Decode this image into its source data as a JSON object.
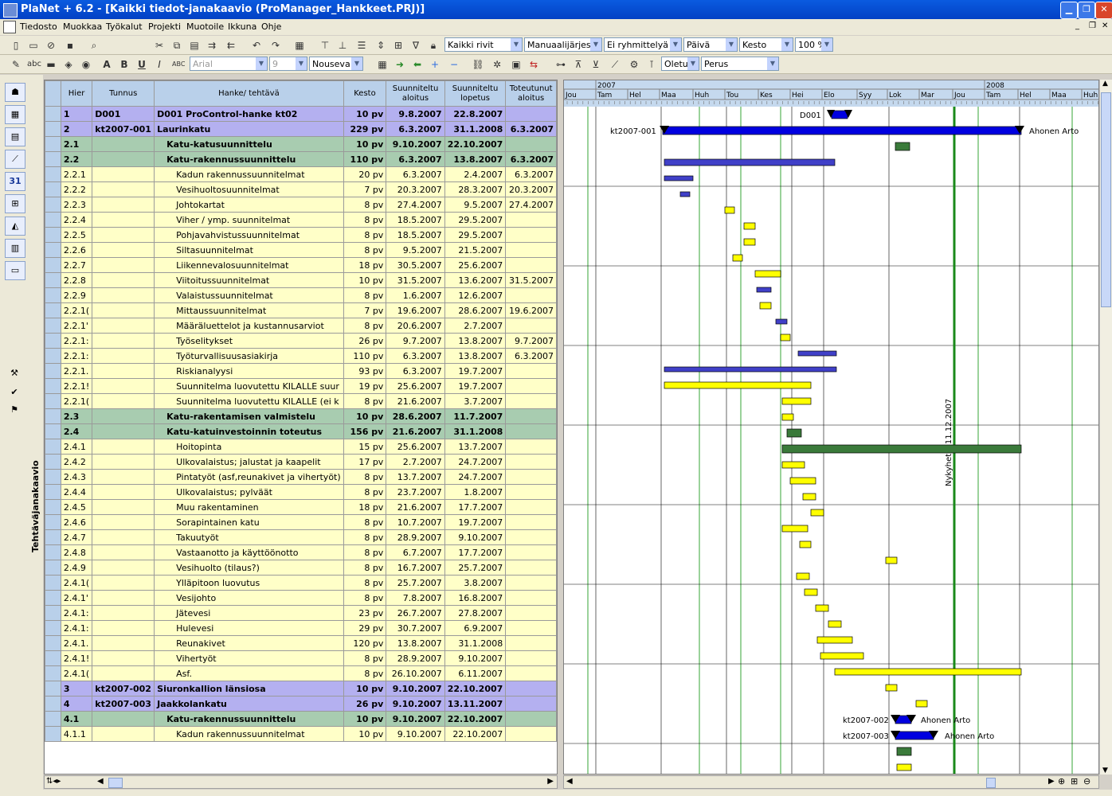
{
  "window": {
    "title": "PlaNet + 6.2 - [Kaikki tiedot-janakaavio (ProManager_Hankkeet.PRJ)]"
  },
  "menu": [
    "Tiedosto",
    "Muokkaa",
    "Työkalut",
    "Projekti",
    "Muotoile",
    "Ikkuna",
    "Ohje"
  ],
  "toolbar1": {
    "filter": "Kaikki rivit",
    "sort": "Manuaalijärjesty",
    "group": "Ei ryhmittelyä",
    "unit": "Päivä",
    "field": "Kesto",
    "zoom": "100 %"
  },
  "toolbar2": {
    "font": "Arial",
    "size": "9",
    "order": "Nouseva",
    "default": "Oletu:",
    "base": "Perus"
  },
  "side_tab": "Tehtäväjanakaavio",
  "columns": [
    "Hier",
    "Tunnus",
    "Hanke/ tehtävä",
    "Kesto",
    "Suunniteltu aloitus",
    "Suunniteltu lopetus",
    "Toteutunut aloitus"
  ],
  "rows": [
    {
      "hier": "1",
      "id": "D001",
      "name": "D001 ProControl-hanke kt02",
      "dur": "10 pv",
      "start": "9.8.2007",
      "end": "22.8.2007",
      "act": "",
      "type": "purple",
      "indent": 0
    },
    {
      "hier": "2",
      "id": "kt2007-001",
      "name": "Laurinkatu",
      "dur": "229 pv",
      "start": "6.3.2007",
      "end": "31.1.2008",
      "act": "6.3.2007",
      "type": "purple",
      "indent": 0
    },
    {
      "hier": "2.1",
      "id": "",
      "name": "Katu-katusuunnittelu",
      "dur": "10 pv",
      "start": "9.10.2007",
      "end": "22.10.2007",
      "act": "",
      "type": "green",
      "indent": 1
    },
    {
      "hier": "2.2",
      "id": "",
      "name": "Katu-rakennussuunnittelu",
      "dur": "110 pv",
      "start": "6.3.2007",
      "end": "13.8.2007",
      "act": "6.3.2007",
      "type": "green",
      "indent": 1
    },
    {
      "hier": "2.2.1",
      "id": "",
      "name": "Kadun rakennussuunnitelmat",
      "dur": "20 pv",
      "start": "6.3.2007",
      "end": "2.4.2007",
      "act": "6.3.2007",
      "type": "yellow",
      "indent": 2
    },
    {
      "hier": "2.2.2",
      "id": "",
      "name": "Vesihuoltosuunnitelmat",
      "dur": "7 pv",
      "start": "20.3.2007",
      "end": "28.3.2007",
      "act": "20.3.2007",
      "type": "yellow",
      "indent": 2
    },
    {
      "hier": "2.2.3",
      "id": "",
      "name": "Johtokartat",
      "dur": "8 pv",
      "start": "27.4.2007",
      "end": "9.5.2007",
      "act": "27.4.2007",
      "type": "yellow",
      "indent": 2
    },
    {
      "hier": "2.2.4",
      "id": "",
      "name": "Viher / ymp. suunnitelmat",
      "dur": "8 pv",
      "start": "18.5.2007",
      "end": "29.5.2007",
      "act": "",
      "type": "yellow",
      "indent": 2
    },
    {
      "hier": "2.2.5",
      "id": "",
      "name": "Pohjavahvistussuunnitelmat",
      "dur": "8 pv",
      "start": "18.5.2007",
      "end": "29.5.2007",
      "act": "",
      "type": "yellow",
      "indent": 2
    },
    {
      "hier": "2.2.6",
      "id": "",
      "name": "Siltasuunnitelmat",
      "dur": "8 pv",
      "start": "9.5.2007",
      "end": "21.5.2007",
      "act": "",
      "type": "yellow",
      "indent": 2
    },
    {
      "hier": "2.2.7",
      "id": "",
      "name": "Liikennevalosuunnitelmat",
      "dur": "18 pv",
      "start": "30.5.2007",
      "end": "25.6.2007",
      "act": "",
      "type": "yellow",
      "indent": 2
    },
    {
      "hier": "2.2.8",
      "id": "",
      "name": "Viitoitussuunnitelmat",
      "dur": "10 pv",
      "start": "31.5.2007",
      "end": "13.6.2007",
      "act": "31.5.2007",
      "type": "yellow",
      "indent": 2
    },
    {
      "hier": "2.2.9",
      "id": "",
      "name": "Valaistussuunnitelmat",
      "dur": "8 pv",
      "start": "1.6.2007",
      "end": "12.6.2007",
      "act": "",
      "type": "yellow",
      "indent": 2
    },
    {
      "hier": "2.2.1(",
      "id": "",
      "name": "Mittaussuunnitelmat",
      "dur": "7 pv",
      "start": "19.6.2007",
      "end": "28.6.2007",
      "act": "19.6.2007",
      "type": "yellow",
      "indent": 2
    },
    {
      "hier": "2.2.1'",
      "id": "",
      "name": "Määräluettelot ja kustannusarviot",
      "dur": "8 pv",
      "start": "20.6.2007",
      "end": "2.7.2007",
      "act": "",
      "type": "yellow",
      "indent": 2
    },
    {
      "hier": "2.2.1:",
      "id": "",
      "name": "Työselitykset",
      "dur": "26 pv",
      "start": "9.7.2007",
      "end": "13.8.2007",
      "act": "9.7.2007",
      "type": "yellow",
      "indent": 2
    },
    {
      "hier": "2.2.1:",
      "id": "",
      "name": "Työturvallisuusasiakirja",
      "dur": "110 pv",
      "start": "6.3.2007",
      "end": "13.8.2007",
      "act": "6.3.2007",
      "type": "yellow",
      "indent": 2
    },
    {
      "hier": "2.2.1.",
      "id": "",
      "name": "Riskianalyysi",
      "dur": "93 pv",
      "start": "6.3.2007",
      "end": "19.7.2007",
      "act": "",
      "type": "yellow",
      "indent": 2
    },
    {
      "hier": "2.2.1!",
      "id": "",
      "name": "Suunnitelma luovutettu KILALLE suur",
      "dur": "19 pv",
      "start": "25.6.2007",
      "end": "19.7.2007",
      "act": "",
      "type": "yellow",
      "indent": 2
    },
    {
      "hier": "2.2.1(",
      "id": "",
      "name": "Suunnitelma luovutettu KILALLE (ei k",
      "dur": "8 pv",
      "start": "21.6.2007",
      "end": "3.7.2007",
      "act": "",
      "type": "yellow",
      "indent": 2
    },
    {
      "hier": "2.3",
      "id": "",
      "name": "Katu-rakentamisen valmistelu",
      "dur": "10 pv",
      "start": "28.6.2007",
      "end": "11.7.2007",
      "act": "",
      "type": "green",
      "indent": 1
    },
    {
      "hier": "2.4",
      "id": "",
      "name": "Katu-katuinvestoinnin toteutus",
      "dur": "156 pv",
      "start": "21.6.2007",
      "end": "31.1.2008",
      "act": "",
      "type": "green",
      "indent": 1
    },
    {
      "hier": "2.4.1",
      "id": "",
      "name": "Hoitopinta",
      "dur": "15 pv",
      "start": "25.6.2007",
      "end": "13.7.2007",
      "act": "",
      "type": "yellow",
      "indent": 2
    },
    {
      "hier": "2.4.2",
      "id": "",
      "name": "Ulkovalaistus; jalustat ja kaapelit",
      "dur": "17 pv",
      "start": "2.7.2007",
      "end": "24.7.2007",
      "act": "",
      "type": "yellow",
      "indent": 2
    },
    {
      "hier": "2.4.3",
      "id": "",
      "name": "Pintatyöt (asf,reunakivet ja vihertyöt)",
      "dur": "8 pv",
      "start": "13.7.2007",
      "end": "24.7.2007",
      "act": "",
      "type": "yellow",
      "indent": 2
    },
    {
      "hier": "2.4.4",
      "id": "",
      "name": "Ulkovalaistus; pylväät",
      "dur": "8 pv",
      "start": "23.7.2007",
      "end": "1.8.2007",
      "act": "",
      "type": "yellow",
      "indent": 2
    },
    {
      "hier": "2.4.5",
      "id": "",
      "name": "Muu rakentaminen",
      "dur": "18 pv",
      "start": "21.6.2007",
      "end": "17.7.2007",
      "act": "",
      "type": "yellow",
      "indent": 2
    },
    {
      "hier": "2.4.6",
      "id": "",
      "name": "Sorapintainen katu",
      "dur": "8 pv",
      "start": "10.7.2007",
      "end": "19.7.2007",
      "act": "",
      "type": "yellow",
      "indent": 2
    },
    {
      "hier": "2.4.7",
      "id": "",
      "name": "Takuutyöt",
      "dur": "8 pv",
      "start": "28.9.2007",
      "end": "9.10.2007",
      "act": "",
      "type": "yellow",
      "indent": 2
    },
    {
      "hier": "2.4.8",
      "id": "",
      "name": "Vastaanotto ja käyttöönotto",
      "dur": "8 pv",
      "start": "6.7.2007",
      "end": "17.7.2007",
      "act": "",
      "type": "yellow",
      "indent": 2
    },
    {
      "hier": "2.4.9",
      "id": "",
      "name": "Vesihuolto (tilaus?)",
      "dur": "8 pv",
      "start": "16.7.2007",
      "end": "25.7.2007",
      "act": "",
      "type": "yellow",
      "indent": 2
    },
    {
      "hier": "2.4.1(",
      "id": "",
      "name": "Ylläpitoon luovutus",
      "dur": "8 pv",
      "start": "25.7.2007",
      "end": "3.8.2007",
      "act": "",
      "type": "yellow",
      "indent": 2
    },
    {
      "hier": "2.4.1'",
      "id": "",
      "name": "Vesijohto",
      "dur": "8 pv",
      "start": "7.8.2007",
      "end": "16.8.2007",
      "act": "",
      "type": "yellow",
      "indent": 2
    },
    {
      "hier": "2.4.1:",
      "id": "",
      "name": "Jätevesi",
      "dur": "23 pv",
      "start": "26.7.2007",
      "end": "27.8.2007",
      "act": "",
      "type": "yellow",
      "indent": 2
    },
    {
      "hier": "2.4.1:",
      "id": "",
      "name": "Hulevesi",
      "dur": "29 pv",
      "start": "30.7.2007",
      "end": "6.9.2007",
      "act": "",
      "type": "yellow",
      "indent": 2
    },
    {
      "hier": "2.4.1.",
      "id": "",
      "name": "Reunakivet",
      "dur": "120 pv",
      "start": "13.8.2007",
      "end": "31.1.2008",
      "act": "",
      "type": "yellow",
      "indent": 2
    },
    {
      "hier": "2.4.1!",
      "id": "",
      "name": "Vihertyöt",
      "dur": "8 pv",
      "start": "28.9.2007",
      "end": "9.10.2007",
      "act": "",
      "type": "yellow",
      "indent": 2
    },
    {
      "hier": "2.4.1(",
      "id": "",
      "name": "Asf.",
      "dur": "8 pv",
      "start": "26.10.2007",
      "end": "6.11.2007",
      "act": "",
      "type": "yellow",
      "indent": 2
    },
    {
      "hier": "3",
      "id": "kt2007-002",
      "name": "Siuronkallion länsiosa",
      "dur": "10 pv",
      "start": "9.10.2007",
      "end": "22.10.2007",
      "act": "",
      "type": "purple",
      "indent": 0
    },
    {
      "hier": "4",
      "id": "kt2007-003",
      "name": "Jaakkolankatu",
      "dur": "26 pv",
      "start": "9.10.2007",
      "end": "13.11.2007",
      "act": "",
      "type": "purple",
      "indent": 0
    },
    {
      "hier": "4.1",
      "id": "",
      "name": "Katu-rakennussuunnittelu",
      "dur": "10 pv",
      "start": "9.10.2007",
      "end": "22.10.2007",
      "act": "",
      "type": "green",
      "indent": 1
    },
    {
      "hier": "4.1.1",
      "id": "",
      "name": "Kadun rakennussuunnitelmat",
      "dur": "10 pv",
      "start": "9.10.2007",
      "end": "22.10.2007",
      "act": "",
      "type": "yellow",
      "indent": 2
    }
  ],
  "gantt": {
    "years": [
      "2007",
      "2008"
    ],
    "months": [
      "Jou",
      "Tam",
      "Hel",
      "Maa",
      "Huh",
      "Tou",
      "Kes",
      "Hei",
      "Elo",
      "Syy",
      "Lok",
      "Mar",
      "Jou",
      "Tam",
      "Hel",
      "Maa",
      "Huh"
    ],
    "today_label": "Nykyhetki 11.12.2007",
    "labels": {
      "d001": "D001",
      "kt001": "kt2007-001",
      "owner1": "Ahonen Arto",
      "kt002": "kt2007-002",
      "owner2": "Ahonen Arto",
      "kt003": "kt2007-003",
      "owner3": "Ahonen Arto"
    },
    "colors": {
      "yellow": "#ffff00",
      "summary_blue": "#0000e0",
      "summary_green": "#3a7a3a",
      "grid": "#000000",
      "today": "#1a8a1a"
    }
  }
}
